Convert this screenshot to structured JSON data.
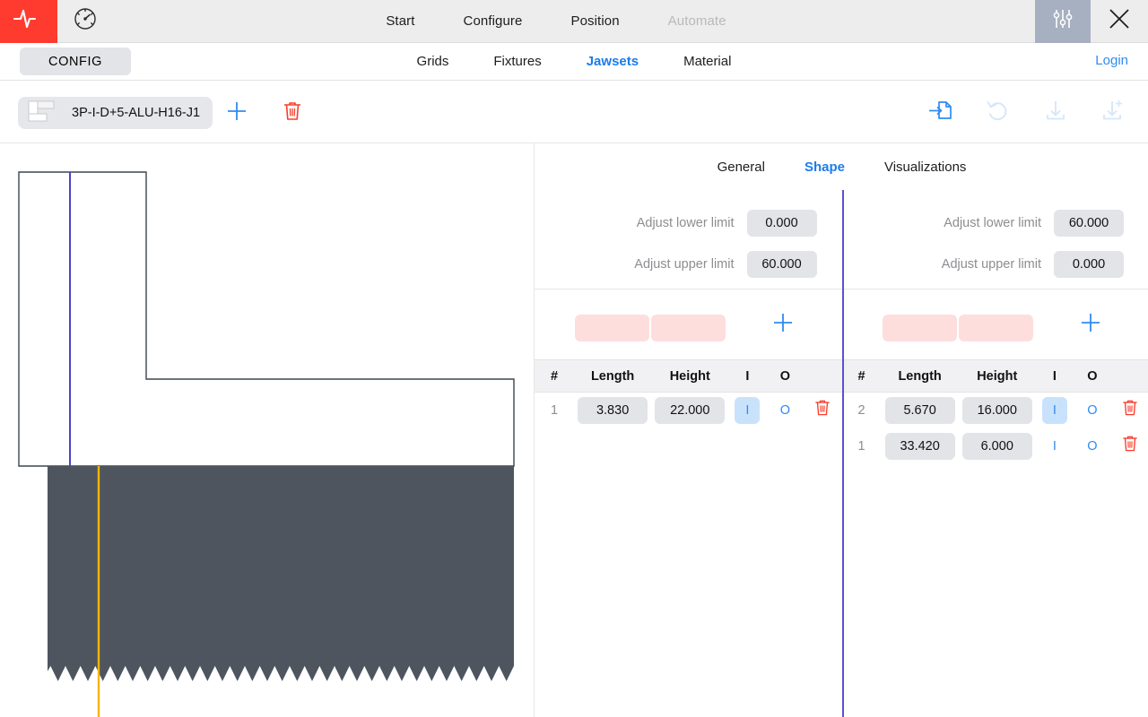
{
  "topbar": {
    "logo_icon": "pulse-logo-icon",
    "gauge_icon": "gauge-icon",
    "nav": [
      {
        "label": "Start",
        "disabled": false
      },
      {
        "label": "Configure",
        "disabled": false
      },
      {
        "label": "Position",
        "disabled": false
      },
      {
        "label": "Automate",
        "disabled": true
      }
    ],
    "sliders_icon": "sliders-icon",
    "close_icon": "close-icon",
    "accent_red": "#ff3b30",
    "accent_blue": "#2f8bf0",
    "sliders_tile_bg": "#a7b0c0"
  },
  "subbar": {
    "config_label": "CONFIG",
    "items": [
      {
        "label": "Grids",
        "active": false
      },
      {
        "label": "Fixtures",
        "active": false
      },
      {
        "label": "Jawsets",
        "active": true
      },
      {
        "label": "Material",
        "active": false
      }
    ],
    "login_label": "Login"
  },
  "jawbar": {
    "chip_label": "3P-I-D+5-ALU-H16-J1",
    "chip_icon": "jaw-profile-icon",
    "add_icon": "plus-icon",
    "delete_icon": "trash-icon",
    "tools": [
      {
        "name": "import-file-icon",
        "enabled": true
      },
      {
        "name": "undo-icon",
        "enabled": false
      },
      {
        "name": "save-icon",
        "enabled": false
      },
      {
        "name": "save-as-icon",
        "enabled": false
      }
    ]
  },
  "tabs": [
    {
      "label": "General",
      "active": false
    },
    {
      "label": "Shape",
      "active": true
    },
    {
      "label": "Visualizations",
      "active": false
    }
  ],
  "panels": [
    {
      "side": "left",
      "limits": [
        {
          "label": "Adjust lower limit",
          "value": "0.000"
        },
        {
          "label": "Adjust upper limit",
          "value": "60.000"
        }
      ],
      "new_row": {
        "length_placeholder": "",
        "height_placeholder": "",
        "add_icon": "plus-icon"
      },
      "columns": [
        "#",
        "Length",
        "Height",
        "I",
        "O"
      ],
      "rows": [
        {
          "num": "1",
          "length": "3.830",
          "height": "22.000",
          "i": "I",
          "o": "O",
          "selected": "I",
          "delete_icon": "trash-icon"
        }
      ]
    },
    {
      "side": "right",
      "limits": [
        {
          "label": "Adjust lower limit",
          "value": "60.000"
        },
        {
          "label": "Adjust upper limit",
          "value": "0.000"
        }
      ],
      "new_row": {
        "length_placeholder": "",
        "height_placeholder": "",
        "add_icon": "plus-icon"
      },
      "columns": [
        "#",
        "Length",
        "Height",
        "I",
        "O"
      ],
      "rows": [
        {
          "num": "2",
          "length": "5.670",
          "height": "16.000",
          "i": "I",
          "o": "O",
          "selected": "I",
          "delete_icon": "trash-icon"
        },
        {
          "num": "1",
          "length": "33.420",
          "height": "6.000",
          "i": "I",
          "o": "O",
          "selected": "",
          "delete_icon": "trash-icon"
        }
      ]
    }
  ],
  "viewport": {
    "name": "jaw-shape-preview",
    "outline_color": "#3d4450",
    "centerline_color": "#4b44c9",
    "jaw_body_color": "#4e555f",
    "jaw_centerline_color": "#f5b50a",
    "teeth_count": 30
  }
}
